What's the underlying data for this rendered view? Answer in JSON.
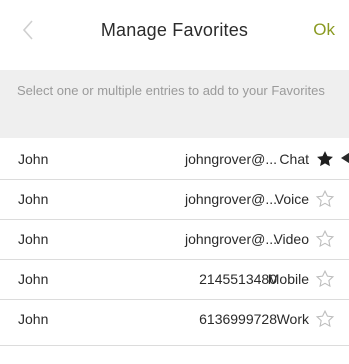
{
  "header": {
    "title": "Manage Favorites",
    "ok_label": "Ok"
  },
  "instructions": "Select one or multiple entries to add to your Favorites",
  "colors": {
    "accent": "#8a9a22",
    "star_filled": "#1f1f1f",
    "star_outline": "#bdbdbd",
    "instructions_bg": "#efefef"
  },
  "entries": [
    {
      "name": "John",
      "address": "johngrover@...",
      "type": "Chat",
      "favorite": true
    },
    {
      "name": "John",
      "address": "johngrover@...",
      "type": "Voice",
      "favorite": false
    },
    {
      "name": "John",
      "address": "johngrover@...",
      "type": "Video",
      "favorite": false
    },
    {
      "name": "John",
      "address": "2145513480",
      "type": "Mobile",
      "favorite": false
    },
    {
      "name": "John",
      "address": "6136999728",
      "type": "Work",
      "favorite": false
    }
  ],
  "icons": {
    "back": "chevron-left-icon",
    "favorite_on": "star-filled-icon",
    "favorite_off": "star-outline-icon",
    "swipe": "swipe-handle-icon"
  }
}
